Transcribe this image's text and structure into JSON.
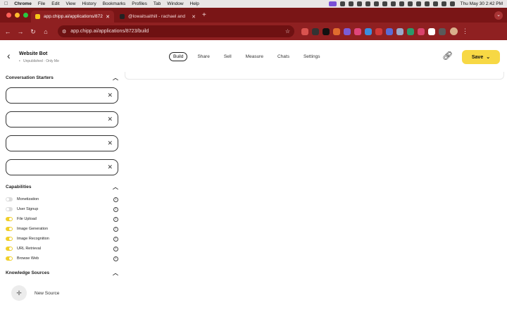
{
  "menubar": {
    "app_name": "Chrome",
    "items": [
      "File",
      "Edit",
      "View",
      "History",
      "Bookmarks",
      "Profiles",
      "Tab",
      "Window",
      "Help"
    ],
    "datetime": "Thu May 30  2:42 PM"
  },
  "tabs": [
    {
      "title": "app.chipp.ai/applications/872",
      "active": true,
      "favicon_color": "#f5c518"
    },
    {
      "title": "@lowaitsaithill - rachael and",
      "active": false,
      "favicon_color": "#222222"
    }
  ],
  "toolbar": {
    "url": "app.chipp.ai/applications/8723/build",
    "extension_colors": [
      "#d9534f",
      "#333333",
      "#111111",
      "#e06c2e",
      "#7b5cd6",
      "#e0457b",
      "#3c8dde",
      "#d33a3a",
      "#5b6bd6",
      "#9aa9c9",
      "#2b9a6b",
      "#d9426b",
      "#ffffff",
      "#5a5a5a"
    ]
  },
  "header": {
    "bot_name": "Website Bot",
    "bot_meta": "Unpublished · Only Me",
    "tabs": [
      "Build",
      "Share",
      "Sell",
      "Measure",
      "Chats",
      "Settings"
    ],
    "active_tab": "Build",
    "save_label": "Save"
  },
  "sidebar": {
    "conversation_starters": {
      "title": "Conversation Starters",
      "inputs": [
        "",
        "",
        "",
        ""
      ]
    },
    "capabilities": {
      "title": "Capabilities",
      "items": [
        {
          "label": "Monetization",
          "enabled": false
        },
        {
          "label": "User Signup",
          "enabled": false
        },
        {
          "label": "File Upload",
          "enabled": true
        },
        {
          "label": "Image Generation",
          "enabled": true
        },
        {
          "label": "Image Recognition",
          "enabled": true
        },
        {
          "label": "URL Retrieval",
          "enabled": true
        },
        {
          "label": "Browse Web",
          "enabled": true
        }
      ]
    },
    "knowledge_sources": {
      "title": "Knowledge Sources",
      "new_source_label": "New Source"
    }
  },
  "colors": {
    "tab_strip": "#7a1516",
    "toolbar": "#8f2021",
    "accent_yellow": "#f7d844",
    "toggle_on": "#f0cf2a"
  }
}
